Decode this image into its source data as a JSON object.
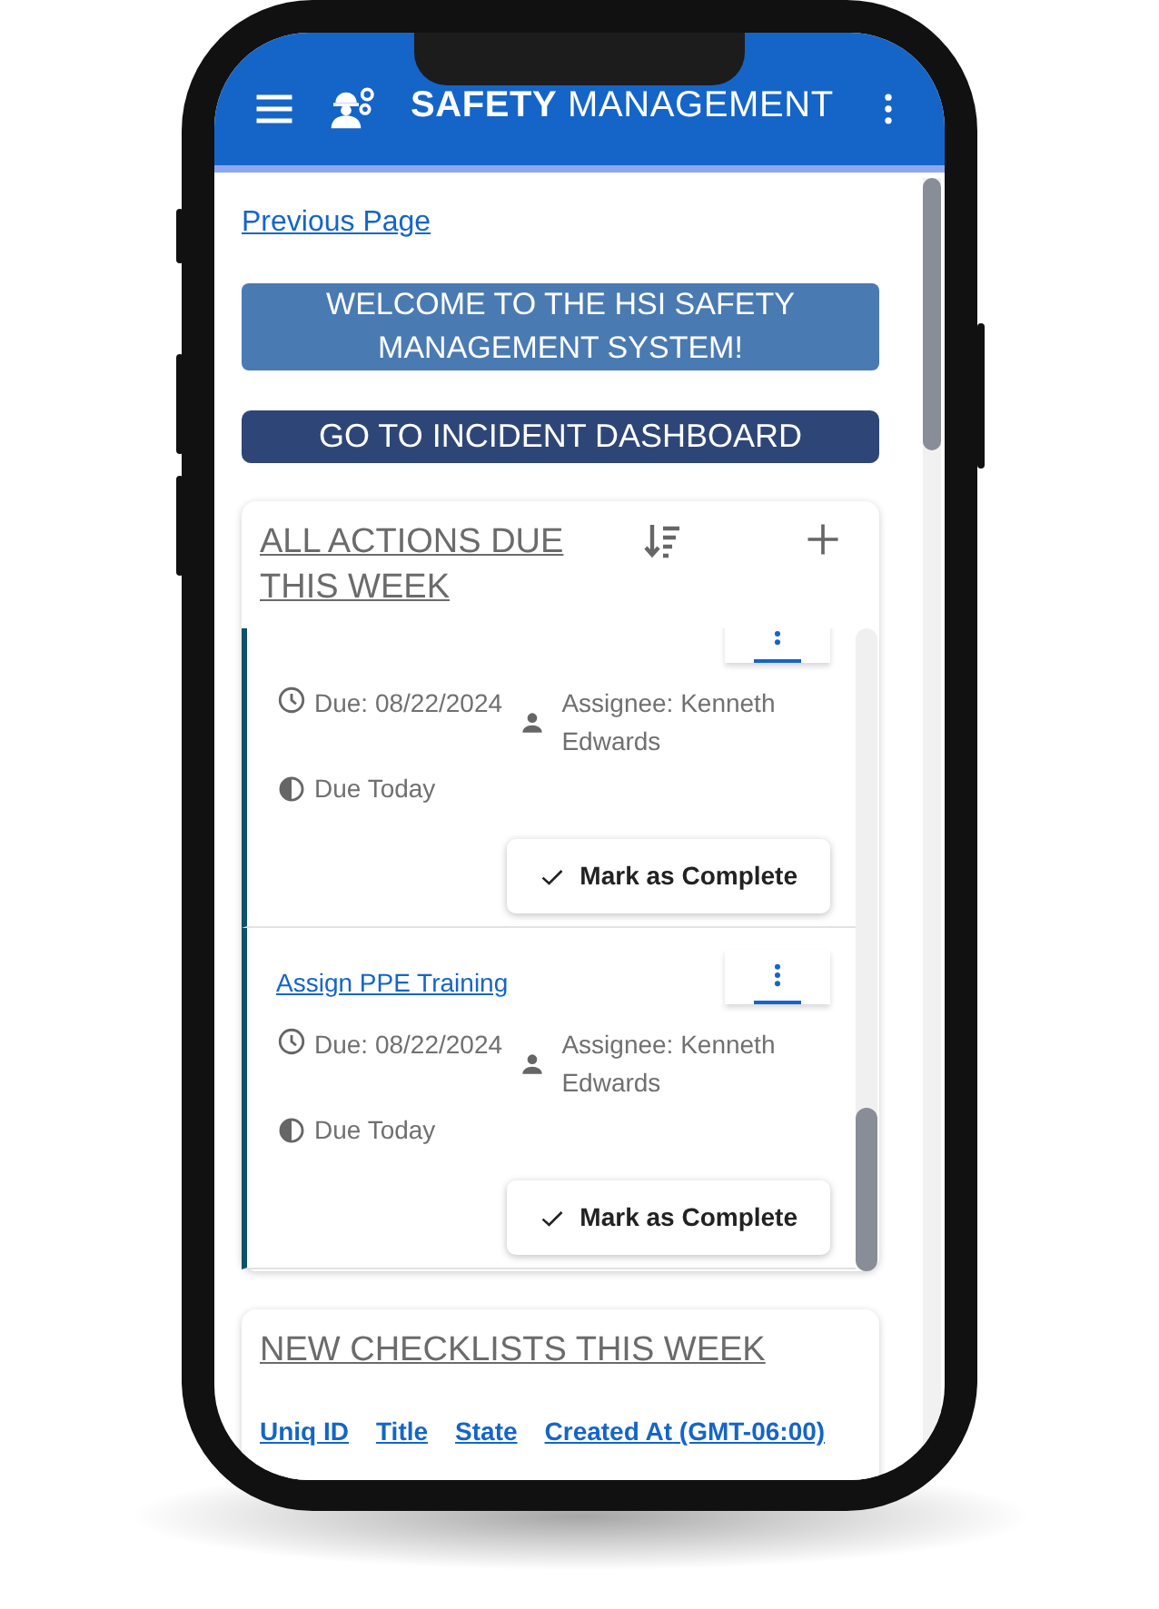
{
  "app_bar": {
    "title_bold": "SAFETY",
    "title_rest": "MANAGEMENT"
  },
  "previous_link": "Previous Page",
  "welcome_banner": "WELCOME TO THE HSI SAFETY MANAGEMENT SYSTEM!",
  "dashboard_button": "GO TO INCIDENT DASHBOARD",
  "actions_panel": {
    "title": "ALL ACTIONS DUE THIS WEEK",
    "items": [
      {
        "due": "Due: 08/22/2024",
        "assignee": "Assignee: Kenneth Edwards",
        "status": "Due Today",
        "action": "Mark as Complete"
      },
      {
        "title": "Assign PPE Training",
        "due": "Due: 08/22/2024",
        "assignee": "Assignee: Kenneth Edwards",
        "status": "Due Today",
        "action": "Mark as Complete"
      }
    ]
  },
  "checklists_panel": {
    "title": "NEW CHECKLISTS THIS WEEK",
    "columns": [
      "Uniq ID",
      "Title",
      "State",
      "Created At (GMT-06:00)"
    ]
  }
}
